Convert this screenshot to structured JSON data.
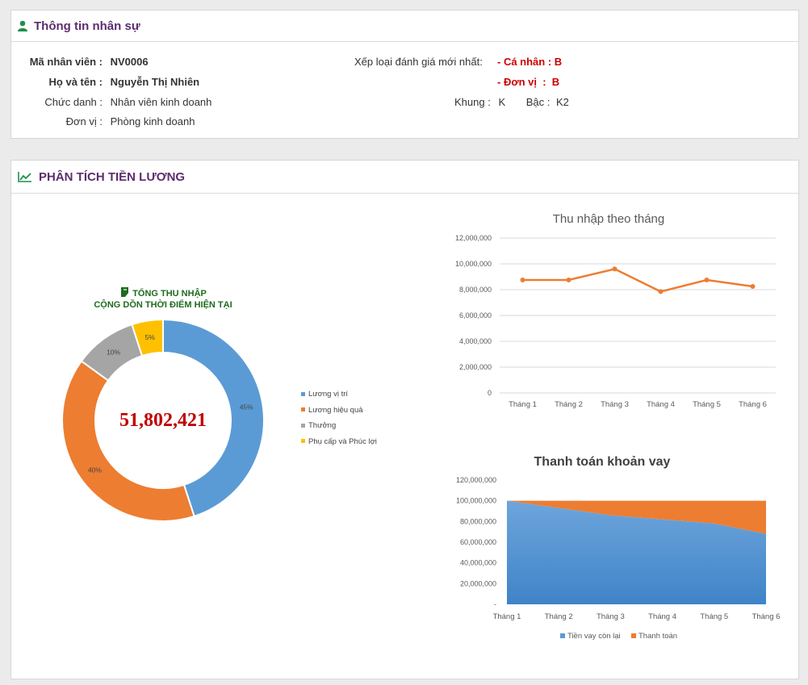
{
  "info": {
    "title": "Thông tin nhân sự",
    "emp_id_label": "Mã nhân viên :",
    "emp_id": "NV0006",
    "name_label": "Họ và tên :",
    "name": "Nguyễn Thị Nhiên",
    "position_label": "Chức danh :",
    "position": "Nhân viên kinh doanh",
    "unit_label": "Đơn vị :",
    "unit": "Phòng kinh doanh",
    "rating_label": "Xếp loại đánh giá mới nhất:",
    "rating_personal": "- Cá nhân : B",
    "rating_unit": "- Đơn vị  :  B",
    "frame_label": "Khung :",
    "frame": "K",
    "grade_label": "Bậc :",
    "grade": "K2"
  },
  "analysis": {
    "title": "PHÂN TÍCH TIỀN LƯƠNG",
    "donut_title1": "TỔNG THU NHẬP",
    "donut_title2": "CỘNG DỒN THỜI ĐIỂM HIỆN TẠI",
    "total": "51,802,421"
  },
  "colors": {
    "blue": "#5b9bd5",
    "orange": "#ed7d31",
    "gray": "#a5a5a5",
    "yellow": "#ffc000",
    "header_purple": "#5c2d6e",
    "green": "#1e6b1e",
    "red": "#c00000"
  },
  "chart_data": [
    {
      "type": "pie",
      "categories": [
        "Lương vị trí",
        "Lương hiệu quả",
        "Thưởng",
        "Phụ cấp và Phúc lợi"
      ],
      "values": [
        45,
        40,
        10,
        5
      ],
      "labels": [
        "45%",
        "40%",
        "10%",
        "5%"
      ]
    },
    {
      "type": "line",
      "title": "Thu nhập theo tháng",
      "categories": [
        "Tháng 1",
        "Tháng 2",
        "Tháng 3",
        "Tháng 4",
        "Tháng 5",
        "Tháng 6"
      ],
      "values": [
        8750000,
        8750000,
        9600000,
        7850000,
        8750000,
        8250000
      ],
      "ylim": [
        0,
        12000000
      ],
      "yticks": [
        "12,000,000",
        "10,000,000",
        "8,000,000",
        "6,000,000",
        "4,000,000",
        "2,000,000",
        "0"
      ],
      "grid": true
    },
    {
      "type": "area",
      "title": "Thanh toán khoản vay",
      "categories": [
        "Tháng 1",
        "Tháng 2",
        "Tháng 3",
        "Tháng 4",
        "Tháng 5",
        "Tháng 6"
      ],
      "series": [
        {
          "name": "Tiền vay còn lại",
          "values": [
            100000000,
            93000000,
            86000000,
            82000000,
            78000000,
            68000000
          ]
        },
        {
          "name": "Thanh toán",
          "values": [
            0,
            7000000,
            14000000,
            18000000,
            22000000,
            32000000
          ]
        }
      ],
      "ylim": [
        0,
        120000000
      ],
      "yticks": [
        "120,000,000",
        "100,000,000",
        "80,000,000",
        "60,000,000",
        "40,000,000",
        "20,000,000",
        "-"
      ],
      "stacked": true
    }
  ]
}
